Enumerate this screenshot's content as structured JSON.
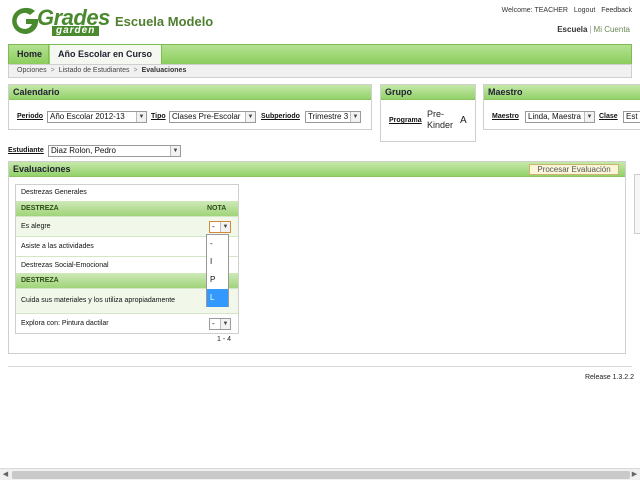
{
  "header": {
    "logo_word": "Grades",
    "logo_sub": "garden",
    "school_name": "Escuela Modelo",
    "welcome": "Welcome: TEACHER",
    "logout": "Logout",
    "feedback": "Feedback",
    "escuela": "Escuela",
    "sep": "|",
    "mi_cuenta": "Mi Cuenta"
  },
  "nav": {
    "tabs": [
      {
        "label": "Home"
      },
      {
        "label": "Año Escolar en Curso"
      }
    ]
  },
  "breadcrumb": {
    "items": [
      "Opciones",
      "Listado de Estudiantes",
      "Evaluaciones"
    ],
    "arrow": ">"
  },
  "calendario": {
    "title": "Calendario",
    "periodo_label": "Periodo",
    "periodo_value": "Año Escolar 2012-13",
    "tipo_label": "Tipo",
    "tipo_value": "Clases Pre-Escolar",
    "subperiodo_label": "Subperiodo",
    "subperiodo_value": "Trimestre 3"
  },
  "grupo": {
    "title": "Grupo",
    "programa_label": "Programa",
    "programa_line1": "Pre-",
    "programa_line2": "Kinder",
    "seccion": "A"
  },
  "maestro": {
    "title": "Maestro",
    "maestro_label": "Maestro",
    "maestro_value": "Linda, Maestra",
    "clase_label": "Clase",
    "clase_value": "Est"
  },
  "estudiante": {
    "label": "Estudiante",
    "value": "Diaz Rolon, Pedro"
  },
  "evaluaciones": {
    "title": "Evaluaciones",
    "process_button": "Procesar Evaluación",
    "sections": [
      {
        "category": "Destrezas Generales",
        "col_destreza": "DESTREZA",
        "col_nota": "NOTA",
        "items": [
          {
            "label": "Es alegre",
            "nota": "-"
          },
          {
            "label": "Asiste a las actividades"
          }
        ]
      },
      {
        "category": "Destrezas Social-Emocional",
        "col_destreza": "DESTREZA",
        "items": [
          {
            "label": "Cuida sus materiales y los utiliza apropiadamente"
          },
          {
            "label": "Explora con: Pintura dactilar",
            "nota": "-"
          }
        ]
      }
    ],
    "dropdown_options": [
      "-",
      "I",
      "P",
      "L"
    ],
    "dropdown_selected": "L",
    "pagination": "1 - 4"
  },
  "footer": {
    "release": "Release 1.3.2.2"
  },
  "colors": {
    "accent": "#4a8a2e",
    "header_green": "#93d16a",
    "selected_blue": "#3399ff"
  },
  "icons": [
    "chevron-down-icon",
    "breadcrumb-arrow-icon",
    "logo-icon"
  ]
}
